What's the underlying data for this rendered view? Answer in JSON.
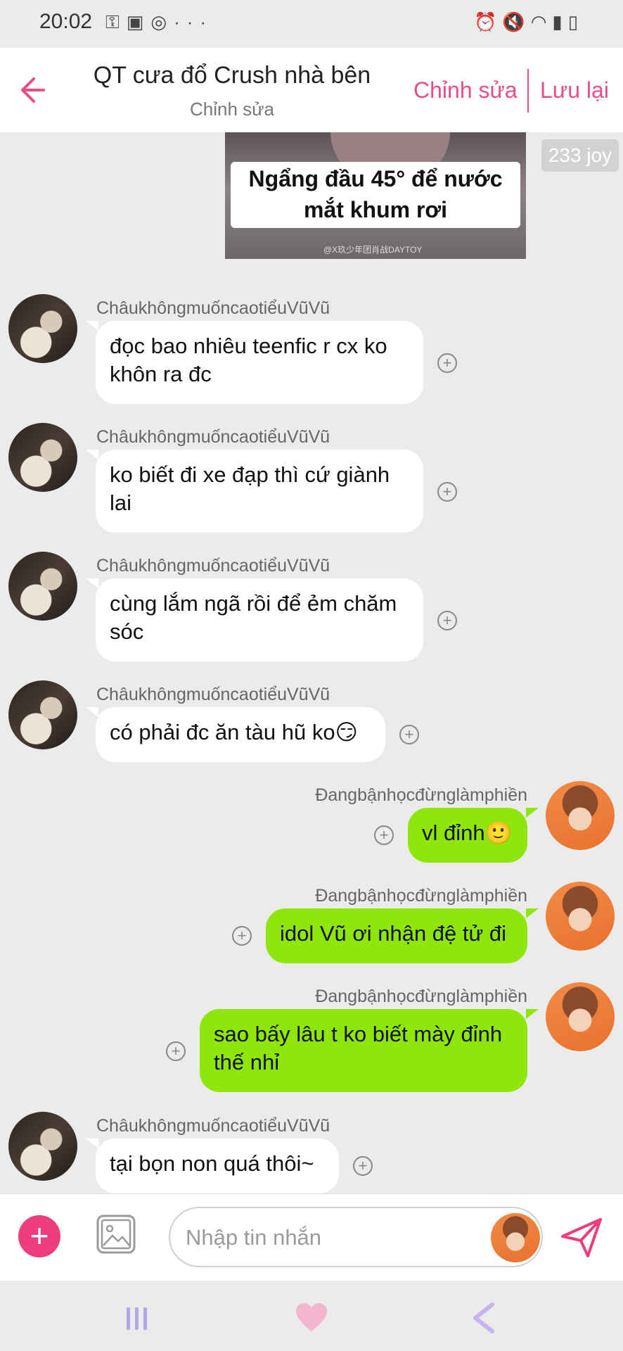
{
  "status_bar": {
    "time": "20:02",
    "left_icons": [
      "key-icon",
      "image-icon",
      "instagram-icon",
      "more-icon"
    ],
    "right_icons": [
      "alarm-icon",
      "mute-icon",
      "wifi-icon",
      "signal-icon",
      "battery-icon"
    ]
  },
  "header": {
    "title": "QT cưa đổ Crush nhà bên",
    "subtitle": "Chỉnh sửa",
    "edit_label": "Chỉnh sửa",
    "save_label": "Lưu lại",
    "accent": "#e84d8a"
  },
  "sticker": {
    "caption_line1": "Ngẩng đầu 45° để nước",
    "caption_line2": "mắt khum rơi",
    "watermark": "@X玖少年团肖战DAYTOY",
    "badge": "233 joy"
  },
  "messages": [
    {
      "side": "left",
      "sender": "ChâukhôngmuốncaotiểuVũVũ",
      "text": "đọc bao nhiêu teenfic r cx ko khôn ra đc"
    },
    {
      "side": "left",
      "sender": "ChâukhôngmuốncaotiểuVũVũ",
      "text": "ko biết đi xe đạp thì cứ giành lai"
    },
    {
      "side": "left",
      "sender": "ChâukhôngmuốncaotiểuVũVũ",
      "text": "cùng lắm ngã rồi để ẻm chăm sóc"
    },
    {
      "side": "left",
      "sender": "ChâukhôngmuốncaotiểuVũVũ",
      "text": "có phải đc ăn tàu hũ ko😏"
    },
    {
      "side": "right",
      "sender": "Đangbậnhọcđừnglàmphiền",
      "text": "vl đỉnh🙂"
    },
    {
      "side": "right",
      "sender": "Đangbậnhọcđừnglàmphiền",
      "text": "idol Vũ ơi nhận đệ tử đi"
    },
    {
      "side": "right",
      "sender": "Đangbậnhọcđừnglàmphiền",
      "text": "sao bấy lâu t ko biết mày đỉnh thế nhỉ"
    },
    {
      "side": "left",
      "sender": "ChâukhôngmuốncaotiểuVũVũ",
      "text": "tại bọn non quá thôi~"
    }
  ],
  "colors": {
    "left_bubble": "#ffffff",
    "right_bubble": "#8fe60a",
    "background": "#ebebeb",
    "add_button": "#ee3d7c"
  },
  "input_bar": {
    "placeholder": "Nhập tin nhắn",
    "add_icon": "plus-icon",
    "image_icon": "image-icon",
    "send_icon": "send-icon"
  },
  "nav_bar": {
    "icons": [
      "recent-apps-icon",
      "heart-home-icon",
      "back-icon"
    ]
  }
}
